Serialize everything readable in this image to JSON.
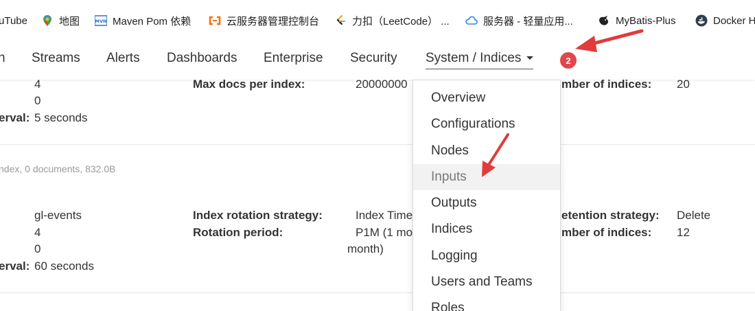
{
  "bookmarks": [
    {
      "label": "uTube",
      "icon": "youtube-icon"
    },
    {
      "label": "地图",
      "icon": "maps-icon"
    },
    {
      "label": "Maven Pom 依赖",
      "icon": "mvn-icon"
    },
    {
      "label": "云服务器管理控制台",
      "icon": "aliyun-icon"
    },
    {
      "label": "力扣（LeetCode） ...",
      "icon": "leetcode-icon"
    },
    {
      "label": "服务器 - 轻量应用...",
      "icon": "cloud-icon"
    },
    {
      "label": "MyBatis-Plus",
      "icon": "mybatis-icon"
    },
    {
      "label": "Docker H",
      "icon": "docker-icon"
    }
  ],
  "nav": {
    "items": [
      "h",
      "Streams",
      "Alerts",
      "Dashboards",
      "Enterprise",
      "Security",
      "System / Indices"
    ],
    "badge": "2"
  },
  "dropdown": {
    "items": [
      "Overview",
      "Configurations",
      "Nodes",
      "Inputs",
      "Outputs",
      "Indices",
      "Logging",
      "Users and Teams",
      "Roles"
    ],
    "hovered": "Inputs"
  },
  "index_set_1": {
    "val_shards": "4",
    "val_replicas": "0",
    "interval_label": "erval:",
    "interval_value": "5 seconds",
    "max_docs_label": "Max docs per index:",
    "max_docs_value": "20000000",
    "max_indices_label": "mber of indices:",
    "max_indices_value": "20"
  },
  "index_set_2": {
    "summary": "ndex, 0 documents, 832.0B",
    "prefix": "gl-events",
    "val_shards": "4",
    "val_replicas": "0",
    "interval_label": "erval:",
    "interval_value": "60 seconds",
    "rotation_strategy_label": "Index rotation strategy:",
    "rotation_strategy_value": "Index Time",
    "rotation_period_label": "Rotation period:",
    "rotation_period_value": "P1M (1 mo",
    "rotation_period_value_2": "month)",
    "retention_label": "etention strategy:",
    "retention_value": "Delete",
    "max_indices_label": "mber of indices:",
    "max_indices_value": "12"
  },
  "colors": {
    "badge": "#e0464c",
    "arrow": "#e23b3b",
    "hover_bg": "#f2f2f2"
  }
}
